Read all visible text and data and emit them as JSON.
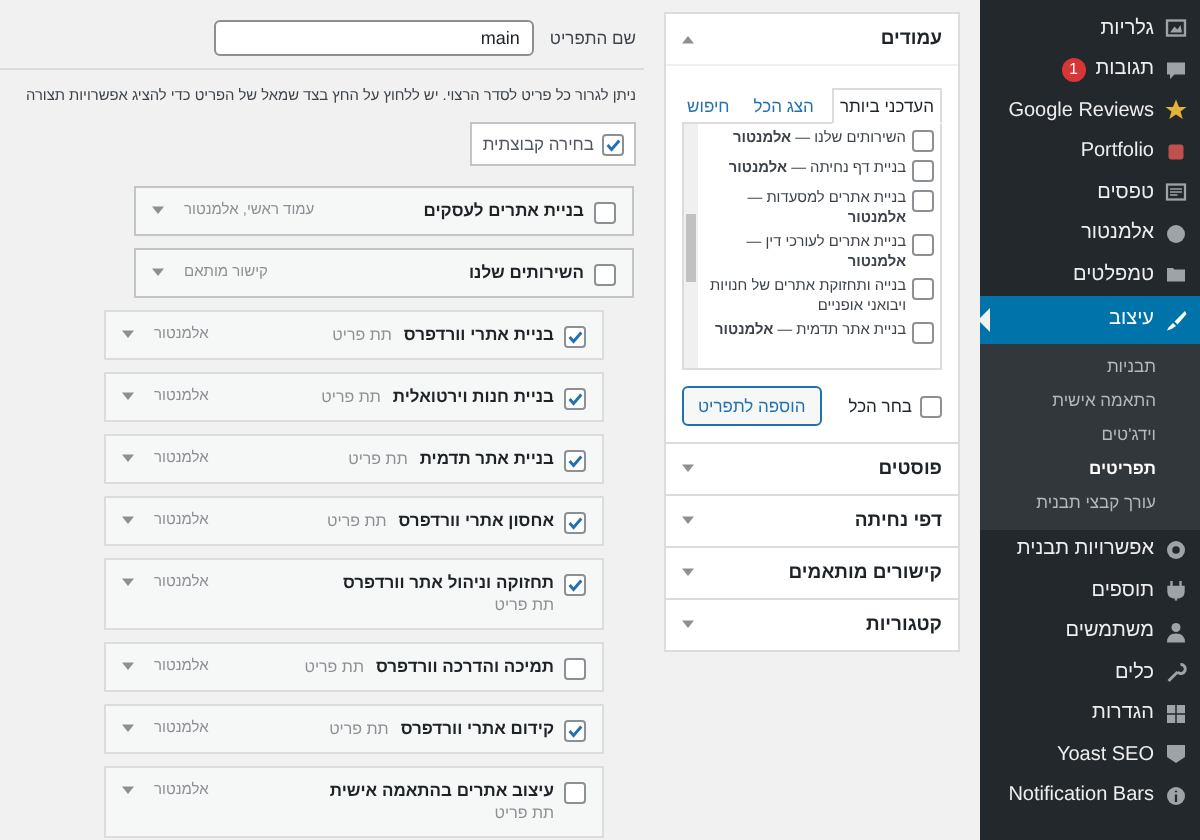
{
  "sidebar": {
    "items": [
      {
        "label": "גלריות",
        "selected": false
      },
      {
        "label": "תגובות",
        "selected": false,
        "badge": "1"
      },
      {
        "label": "Google Reviews",
        "selected": false
      },
      {
        "label": "Portfolio",
        "selected": false
      },
      {
        "label": "טפסים",
        "selected": false
      },
      {
        "label": "אלמנטור",
        "selected": false
      },
      {
        "label": "טמפלטים",
        "selected": false
      },
      {
        "label": "עיצוב",
        "selected": true,
        "children": [
          {
            "label": "תבניות",
            "selected": false
          },
          {
            "label": "התאמה אישית",
            "selected": false
          },
          {
            "label": "וידג'טים",
            "selected": false
          },
          {
            "label": "תפריטים",
            "selected": true
          },
          {
            "label": "עורך קבצי תבנית",
            "selected": false
          }
        ]
      },
      {
        "label": "אפשרויות תבנית",
        "selected": false
      },
      {
        "label": "תוספים",
        "selected": false
      },
      {
        "label": "משתמשים",
        "selected": false
      },
      {
        "label": "כלים",
        "selected": false
      },
      {
        "label": "הגדרות",
        "selected": false
      },
      {
        "label": "Yoast SEO",
        "selected": false
      },
      {
        "label": "Notification Bars",
        "selected": false
      }
    ]
  },
  "add_items": {
    "sections": [
      {
        "title": "עמודים",
        "expanded": true,
        "tabs": [
          {
            "label": "העדכני ביותר",
            "selected": true
          },
          {
            "label": "הצג הכל",
            "selected": false
          },
          {
            "label": "חיפוש",
            "selected": false
          }
        ],
        "options": [
          {
            "label": "השירותים שלנו — **אלמנטור**",
            "checked": false
          },
          {
            "label": "בניית דף נחיתה — **אלמנטור**",
            "checked": false
          },
          {
            "label": "בניית אתרים למסעדות — **אלמנטור**",
            "checked": false
          },
          {
            "label": "בניית אתרים לעורכי דין — **אלמנטור**",
            "checked": false
          },
          {
            "label": "בנייה ותחזוקת אתרים של חנויות ויבואני אופניים",
            "checked": false
          },
          {
            "label": "בניית אתר תדמית — **אלמנטור**",
            "checked": false
          }
        ],
        "select_all": {
          "label": "בחר הכל",
          "checked": false
        },
        "add_button": "הוספה לתפריט"
      },
      {
        "title": "פוסטים",
        "expanded": false
      },
      {
        "title": "דפי נחיתה",
        "expanded": false
      },
      {
        "title": "קישורים מותאמים",
        "expanded": false
      },
      {
        "title": "קטגוריות",
        "expanded": false
      }
    ]
  },
  "menu_editor": {
    "menu_name": {
      "label": "שם התפריט",
      "value": "main"
    },
    "instructions": "ניתן לגרור כל פריט לסדר הרצוי. יש ללחוץ על החץ בצד שמאל של הפריט כדי להציג אפשרויות תצורה",
    "bulk_select": {
      "label": "בחירה קבוצתית",
      "checked": true
    },
    "menu_items": [
      {
        "title": "בניית אתרים לעסקים",
        "type": "עמוד ראשי, אלמנטור",
        "checked": false
      },
      {
        "title": "השירותים שלנו",
        "type": "קישור מותאם",
        "checked": false,
        "children": [
          {
            "title": "בניית אתרי וורדפרס",
            "sub_label": "תת פריט",
            "type": "אלמנטור",
            "checked": true
          },
          {
            "title": "בניית חנות וירטואלית",
            "sub_label": "תת פריט",
            "type": "אלמנטור",
            "checked": true
          },
          {
            "title": "בניית אתר תדמית",
            "sub_label": "תת פריט",
            "type": "אלמנטור",
            "checked": true
          },
          {
            "title": "אחסון אתרי וורדפרס",
            "sub_label": "תת פריט",
            "type": "אלמנטור",
            "checked": true
          },
          {
            "title": "תחזוקה וניהול אתר וורדפרס",
            "sub_label": "תת פריט",
            "type": "אלמנטור",
            "checked": true
          },
          {
            "title": "תמיכה והדרכה וורדפרס",
            "sub_label": "תת פריט",
            "type": "אלמנטור",
            "checked": false
          },
          {
            "title": "קידום אתרי וורדפרס",
            "sub_label": "תת פריט",
            "type": "אלמנטור",
            "checked": true
          },
          {
            "title": "עיצוב אתרים בהתאמה אישית",
            "sub_label": "תת פריט",
            "type": "אלמנטור",
            "checked": false
          }
        ]
      }
    ]
  }
}
